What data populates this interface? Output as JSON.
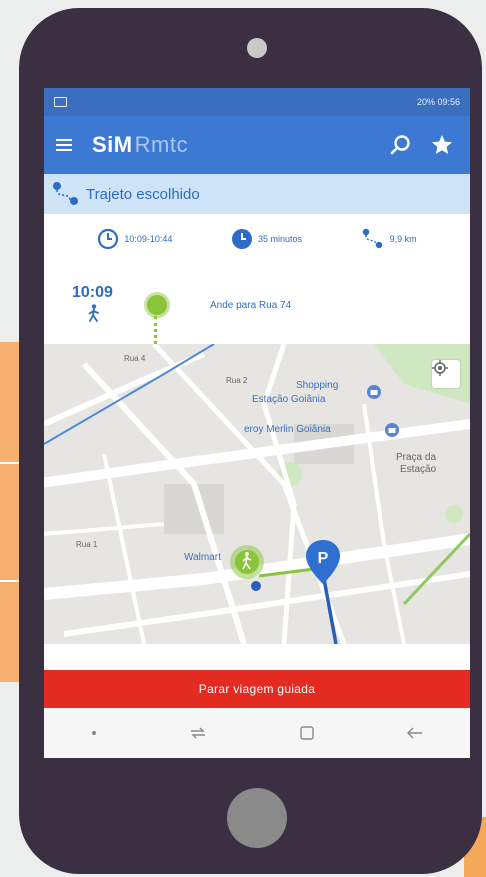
{
  "status_bar": {
    "right_text": "20% 09:56"
  },
  "app_bar": {
    "logo_bold": "SiM",
    "logo_light": "Rmtc",
    "icons": [
      "menu-icon",
      "search-icon",
      "star-icon"
    ]
  },
  "route_header": {
    "title": "Trajeto escolhido"
  },
  "route_stats": {
    "time_range": "10:09-10:44",
    "duration": "35 minutos",
    "distance": "9,9 km"
  },
  "step": {
    "time": "10:09",
    "instruction": "Ande para Rua 74"
  },
  "map_labels": {
    "shopping": "Shopping",
    "estacao_goiania": "Estação Goiânia",
    "leroy": "eroy Merlin Goiânia",
    "praca_line1": "Praça da",
    "praca_line2": "Estação",
    "walmart": "Walmart",
    "rua_1": "Rua 1",
    "rua_2": "Rua 2",
    "rua_4": "Rua 4"
  },
  "bottom_button": {
    "label": "Parar viagem guiada"
  },
  "colors": {
    "primary": "#3c79d2",
    "status": "#3a6fc0",
    "header_bg": "#cfe3f7",
    "accent_green": "#8ac43a",
    "stop_red": "#e32b22",
    "phone_body": "#3a3042"
  }
}
